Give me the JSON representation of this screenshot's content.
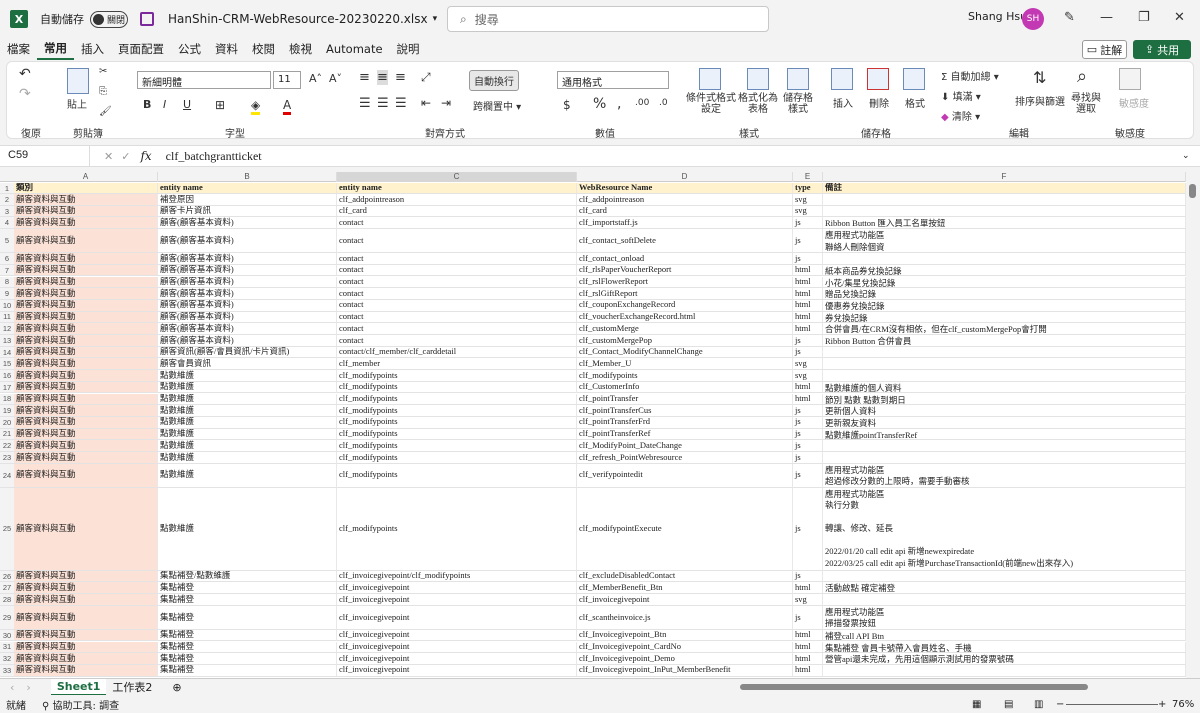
{
  "titlebar": {
    "app_icon": "X",
    "autosave_label": "自動儲存",
    "autosave_state": "關閉",
    "filename": "HanShin-CRM-WebResource-20230220.xlsx",
    "search_placeholder": "搜尋",
    "user_name": "Shang Hsu",
    "user_initials": "SH"
  },
  "menu": {
    "tabs": [
      "檔案",
      "常用",
      "插入",
      "頁面配置",
      "公式",
      "資料",
      "校閱",
      "檢視",
      "Automate",
      "說明"
    ],
    "comment": "註解",
    "share": "共用"
  },
  "ribbon": {
    "undo_group": "復原",
    "clipboard_group": "剪貼簿",
    "paste": "貼上",
    "font_group": "字型",
    "font_name": "新細明體",
    "font_size": "11",
    "align_group": "對齊方式",
    "wrap_text": "自動換行",
    "merge_center": "跨欄置中",
    "number_group": "數值",
    "number_format": "通用格式",
    "styles_group": "樣式",
    "cond_format": "條件式格式設定",
    "format_table": "格式化為表格",
    "cell_styles": "儲存格樣式",
    "cells_group": "儲存格",
    "insert": "插入",
    "delete": "刪除",
    "format": "格式",
    "editing_group": "編輯",
    "autosum": "自動加總",
    "fill": "填滿",
    "clear": "清除",
    "sort_filter": "排序與篩選",
    "find_select": "尋找與選取",
    "sensitivity_group": "敏感度",
    "sensitivity": "敏感度"
  },
  "formula_bar": {
    "name_box": "C59",
    "fx": "fx",
    "formula": "clf_batchgrantticket"
  },
  "sheet": {
    "columns": [
      "A",
      "B",
      "C",
      "D",
      "E",
      "F"
    ],
    "header": [
      "類別",
      "entity name",
      "entity name",
      "WebResource Name",
      "type",
      "備註"
    ],
    "rows": [
      [
        "2",
        "顧客資料與互動",
        "補登原因",
        "clf_addpointreason",
        "clf_addpointreason",
        "svg",
        ""
      ],
      [
        "3",
        "顧客資料與互動",
        "顧客卡片資訊",
        "clf_card",
        "clf_card",
        "svg",
        ""
      ],
      [
        "4",
        "顧客資料與互動",
        "顧客(顧客基本資料)",
        "contact",
        "clf_importstaff.js",
        "js",
        "Ribbon Button 匯入員工名單按鈕"
      ],
      [
        "5",
        "顧客資料與互動",
        "顧客(顧客基本資料)",
        "contact",
        "clf_contact_softDelete",
        "js",
        "應用程式功能區\n聯絡人刪除個資"
      ],
      [
        "6",
        "顧客資料與互動",
        "顧客(顧客基本資料)",
        "contact",
        "clf_contact_onload",
        "js",
        ""
      ],
      [
        "7",
        "顧客資料與互動",
        "顧客(顧客基本資料)",
        "contact",
        "clf_rlsPaperVoucherReport",
        "html",
        "紙本商品券兌換記錄"
      ],
      [
        "8",
        "顧客資料與互動",
        "顧客(顧客基本資料)",
        "contact",
        "clf_rslFlowerReport",
        "html",
        "小花/集星兌換記錄"
      ],
      [
        "9",
        "顧客資料與互動",
        "顧客(顧客基本資料)",
        "contact",
        "clf_rslGiftReport",
        "html",
        "贈品兌換記錄"
      ],
      [
        "10",
        "顧客資料與互動",
        "顧客(顧客基本資料)",
        "contact",
        "clf_couponExchangeRecord",
        "html",
        "優惠券兌換記錄"
      ],
      [
        "11",
        "顧客資料與互動",
        "顧客(顧客基本資料)",
        "contact",
        "clf_voucherExchangeRecord.html",
        "html",
        "券兌換記錄"
      ],
      [
        "12",
        "顧客資料與互動",
        "顧客(顧客基本資料)",
        "contact",
        "clf_customMerge",
        "html",
        "合併會員/在CRM沒有相依，但在clf_customMergePop會打開"
      ],
      [
        "13",
        "顧客資料與互動",
        "顧客(顧客基本資料)",
        "contact",
        "clf_customMergePop",
        "js",
        "Ribbon Button  合併會員"
      ],
      [
        "14",
        "顧客資料與互動",
        "顧客資訊(顧客/會員資訊/卡片資訊)",
        "contact/clf_member/clf_carddetail",
        "clf_Contact_ModifyChannelChange",
        "js",
        ""
      ],
      [
        "15",
        "顧客資料與互動",
        "顧客會員資訊",
        "clf_member",
        "clf_Member_U",
        "svg",
        ""
      ],
      [
        "16",
        "顧客資料與互動",
        "點數維護",
        "clf_modifypoints",
        "clf_modifypoints",
        "svg",
        ""
      ],
      [
        "17",
        "顧客資料與互動",
        "點數維護",
        "clf_modifypoints",
        "clf_CustomerInfo",
        "html",
        "點數維護的個人資料"
      ],
      [
        "18",
        "顧客資料與互動",
        "點數維護",
        "clf_modifypoints",
        "clf_pointTransfer",
        "html",
        "節別  點數  點數到期日"
      ],
      [
        "19",
        "顧客資料與互動",
        "點數維護",
        "clf_modifypoints",
        "clf_pointTransferCus",
        "js",
        "更新個人資料"
      ],
      [
        "20",
        "顧客資料與互動",
        "點數維護",
        "clf_modifypoints",
        "clf_pointTransferFrd",
        "js",
        "更新親友資料"
      ],
      [
        "21",
        "顧客資料與互動",
        "點數維護",
        "clf_modifypoints",
        "clf_pointTransferRef",
        "js",
        "點數維護pointTransferRef"
      ],
      [
        "22",
        "顧客資料與互動",
        "點數維護",
        "clf_modifypoints",
        "clf_ModifyPoint_DateChange",
        "js",
        ""
      ],
      [
        "23",
        "顧客資料與互動",
        "點數維護",
        "clf_modifypoints",
        "clf_refresh_PointWebresource",
        "js",
        ""
      ],
      [
        "24",
        "顧客資料與互動",
        "點數維護",
        "clf_modifypoints",
        "clf_verifypointedit",
        "js",
        "應用程式功能區\n超過修改分數的上限時，需要手動審核"
      ],
      [
        "25",
        "顧客資料與互動",
        "點數維護",
        "clf_modifypoints",
        "clf_modifypointExecute",
        "js",
        "應用程式功能區\n執行分數\n\n轉讓、修改、延長\n\n2022/01/20 call edit api 新增newexpiredate\n2022/03/25 call edit api 新增PurchaseTransactionId(前端new出來存入)"
      ],
      [
        "26",
        "顧客資料與互動",
        "集點補登/點數維護",
        "clf_invoicegivepoint/clf_modifypoints",
        "clf_excludeDisabledContact",
        "js",
        ""
      ],
      [
        "27",
        "顧客資料與互動",
        "集點補登",
        "clf_invoicegivepoint",
        "clf_MemberBenefit_Btn",
        "html",
        "活動啟點 確定補登"
      ],
      [
        "28",
        "顧客資料與互動",
        "集點補登",
        "clf_invoicegivepoint",
        "clf_invoicegivepoint",
        "svg",
        ""
      ],
      [
        "29",
        "顧客資料與互動",
        "集點補登",
        "clf_invoicegivepoint",
        "clf_scantheinvoice.js",
        "js",
        "應用程式功能區\n掃描發票按鈕"
      ],
      [
        "30",
        "顧客資料與互動",
        "集點補登",
        "clf_invoicegivepoint",
        "clf_Invoicegivepoint_Btn",
        "html",
        "補登call API Btn"
      ],
      [
        "31",
        "顧客資料與互動",
        "集點補登",
        "clf_invoicegivepoint",
        "clf_Invoicegivepoint_CardNo",
        "html",
        "集點補登 會員卡號帶入會員姓名、手機"
      ],
      [
        "32",
        "顧客資料與互動",
        "集點補登",
        "clf_invoicegivepoint",
        "clf_Invoicegivepoint_Demo",
        "html",
        "營管api還未完成，先用這個顯示測試用的發票號碼"
      ],
      [
        "33",
        "顧客資料與互動",
        "集點補登",
        "clf_invoicegivepoint",
        "clf_Invoicegivepoint_InPut_MemberBenefit",
        "html",
        ""
      ]
    ]
  },
  "sheet_tabs": [
    "Sheet1",
    "工作表2"
  ],
  "status": {
    "ready": "就緒",
    "accessibility": "協助工具: 調查",
    "zoom": "76%"
  }
}
